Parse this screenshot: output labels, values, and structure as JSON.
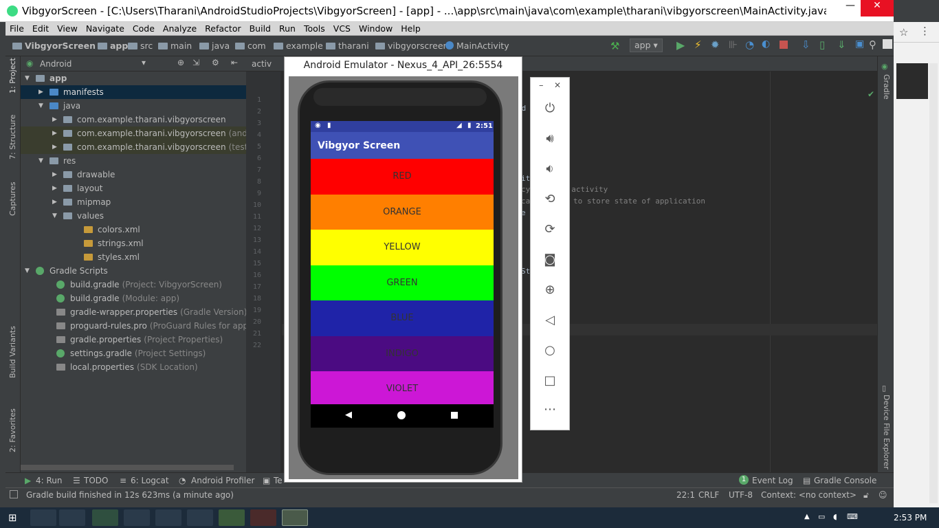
{
  "window": {
    "title": "VibgyorScreen - [C:\\Users\\Tharani\\AndroidStudioProjects\\VibgyorScreen] - [app] - ...\\app\\src\\main\\java\\com\\example\\tharani\\vibgyorscreen\\MainActivity.java - Android Stud...",
    "minimize": "—",
    "maximize": "☐",
    "close": "✕"
  },
  "menu": [
    "File",
    "Edit",
    "View",
    "Navigate",
    "Code",
    "Analyze",
    "Refactor",
    "Build",
    "Run",
    "Tools",
    "VCS",
    "Window",
    "Help"
  ],
  "breadcrumb": [
    "VibgyorScreen",
    "app",
    "src",
    "main",
    "java",
    "com",
    "example",
    "tharani",
    "vibgyorscreen",
    "MainActivity"
  ],
  "toolbar": {
    "run_config": "app"
  },
  "left_tools": [
    "1: Project",
    "7: Structure",
    "Captures",
    "Build Variants",
    "2: Favorites"
  ],
  "right_tools": [
    "Gradle",
    "Device File Explorer"
  ],
  "project_panel": {
    "view_mode": "Android",
    "tree": [
      {
        "label": "app",
        "hint": ""
      },
      {
        "label": "manifests",
        "hint": ""
      },
      {
        "label": "java",
        "hint": ""
      },
      {
        "label": "com.example.tharani.vibgyorscreen",
        "hint": ""
      },
      {
        "label": "com.example.tharani.vibgyorscreen",
        "hint": "(androidTe"
      },
      {
        "label": "com.example.tharani.vibgyorscreen",
        "hint": "(test)"
      },
      {
        "label": "res",
        "hint": ""
      },
      {
        "label": "drawable",
        "hint": ""
      },
      {
        "label": "layout",
        "hint": ""
      },
      {
        "label": "mipmap",
        "hint": ""
      },
      {
        "label": "values",
        "hint": ""
      },
      {
        "label": "colors.xml",
        "hint": ""
      },
      {
        "label": "strings.xml",
        "hint": ""
      },
      {
        "label": "styles.xml",
        "hint": ""
      },
      {
        "label": "Gradle Scripts",
        "hint": ""
      },
      {
        "label": "build.gradle",
        "hint": "(Project: VibgyorScreen)"
      },
      {
        "label": "build.gradle",
        "hint": "(Module: app)"
      },
      {
        "label": "gradle-wrapper.properties",
        "hint": "(Gradle Version)"
      },
      {
        "label": "proguard-rules.pro",
        "hint": "(ProGuard Rules for app)"
      },
      {
        "label": "gradle.properties",
        "hint": "(Project Properties)"
      },
      {
        "label": "settings.gradle",
        "hint": "(Project Settings)"
      },
      {
        "label": "local.properties",
        "hint": "(SDK Location)"
      }
    ]
  },
  "editor": {
    "tab": "activ",
    "line_numbers": [
      "1",
      "2",
      "3",
      "4",
      "5",
      "6",
      "7",
      "8",
      "9",
      "10",
      "11",
      "12",
      "13",
      "14",
      "15",
      "16",
      "17",
      "18",
      "19",
      "20",
      "21",
      "22"
    ],
    "code_fragments": [
      "od",
      "it",
      "cy",
      "n activity",
      "ca",
      "to store state of application",
      "e",
      "St"
    ]
  },
  "emulator": {
    "title": "Android Emulator - Nexus_4_API_26:5554",
    "status_time": "2:51",
    "app_title": "Vibgyor Screen",
    "bands": [
      {
        "label": "RED",
        "color": "#ff0000"
      },
      {
        "label": "ORANGE",
        "color": "#ff7f00"
      },
      {
        "label": "YELLOW",
        "color": "#ffff00"
      },
      {
        "label": "GREEN",
        "color": "#00ff00"
      },
      {
        "label": "BLUE",
        "color": "#1f23a8"
      },
      {
        "label": "INDIGO",
        "color": "#4b0b82"
      },
      {
        "label": "VIOLET",
        "color": "#cc17d6"
      }
    ]
  },
  "emulator_panel": {
    "minimize": "–",
    "close": "✕"
  },
  "bottom_tools": {
    "run": "4: Run",
    "todo": "TODO",
    "logcat": "6: Logcat",
    "profiler": "Android Profiler",
    "terminal": "Te",
    "event_log": "Event Log",
    "event_count": "1",
    "gradle_console": "Gradle Console"
  },
  "status": {
    "message": "Gradle build finished in 12s 623ms (a minute ago)",
    "position": "22:1",
    "line_sep": "CRLF",
    "encoding": "UTF-8",
    "context": "Context: <no context>"
  },
  "taskbar": {
    "time": "2:53 PM"
  }
}
